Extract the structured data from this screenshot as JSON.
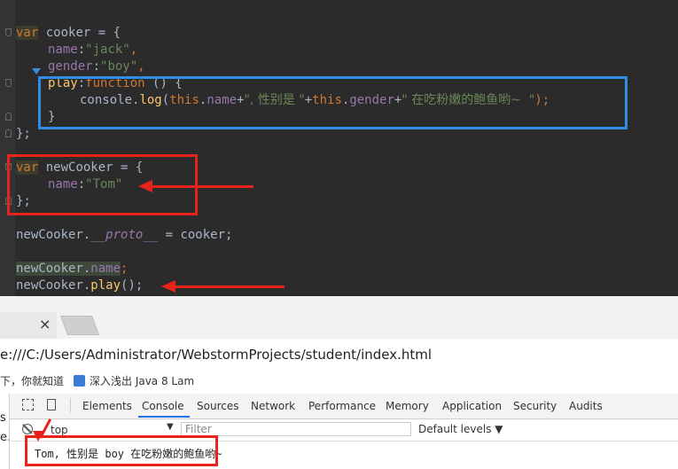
{
  "editor": {
    "lines": [
      {
        "var": "var",
        "name": "cooker",
        "eq": " = {"
      },
      {
        "key": "name",
        "colon": ":",
        "value": "\"jack\"",
        "comma": ","
      },
      {
        "key": "gender",
        "colon": ":",
        "value": "\"boy\"",
        "comma": ","
      },
      {
        "key": "play",
        "colon": ":",
        "fn": "function",
        "rest": " () {"
      },
      {
        "console": "console",
        "dot": ".",
        "log": "log",
        "open": "(",
        "this1": "this",
        "dot1": ".",
        "p1": "name",
        "plus1": "+",
        "s1": "\", 性别是 \"",
        "plus2": "+",
        "this2": "this",
        "dot2": ".",
        "p2": "gender",
        "plus3": "+",
        "s2": "\" 在吃粉嫩的鲍鱼哟~  \"",
        "close": ");"
      },
      {
        "text": "}"
      },
      {
        "text": "};"
      },
      {
        "var": "var",
        "name": "newCooker",
        "eq": " = {"
      },
      {
        "key": "name",
        "colon": ":",
        "value": "\"Tom\""
      },
      {
        "text": "};"
      },
      {
        "obj": "newCooker",
        "dot": ".",
        "proto": "__proto__",
        "rest": " = cooker;"
      },
      {
        "obj": "newCooker",
        "dot": ".",
        "prop": "name",
        "semi": ";"
      },
      {
        "obj": "newCooker",
        "dot": ".",
        "fn": "play",
        "rest": "();"
      }
    ],
    "colors": {
      "background": "#2b2b2b",
      "keyword": "#cc7832",
      "property": "#9876aa",
      "string": "#6a8759",
      "function": "#ffc66d",
      "annotation_red": "#e8231c",
      "annotation_blue": "#2f8de4"
    }
  },
  "browser": {
    "tab_close": "×",
    "url": "e:///C:/Users/Administrator/WebstormProjects/student/index.html",
    "bookmarks": [
      {
        "label": "下，你就知道"
      },
      {
        "label": "深入浅出 Java 8 Lam"
      }
    ],
    "page_remnant": [
      "s",
      "e."
    ]
  },
  "devtools": {
    "tabs": [
      "Elements",
      "Console",
      "Sources",
      "Network",
      "Performance",
      "Memory",
      "Application",
      "Security",
      "Audits"
    ],
    "active_tab": "Console",
    "context": "top",
    "context_caret": "▼",
    "filter_placeholder": "Filter",
    "levels": "Default levels ▼",
    "console_output": "Tom, 性别是 boy 在吃粉嫩的鲍鱼哟~"
  }
}
